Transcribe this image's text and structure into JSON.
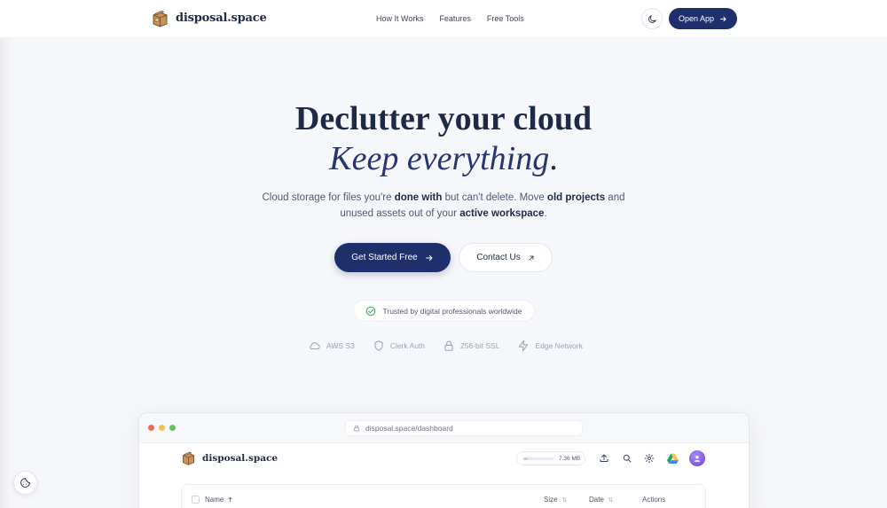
{
  "nav": {
    "brand": "disposal.space",
    "links": [
      "How It Works",
      "Features",
      "Free Tools"
    ],
    "open_app": "Open App"
  },
  "hero": {
    "title": "Declutter your cloud",
    "subtitle": "Keep everything",
    "subtitle_dot": ".",
    "desc_1": "Cloud storage for files you're ",
    "desc_b1": "done with",
    "desc_2": " but can't delete. Move ",
    "desc_b2": "old projects",
    "desc_3": " and unused assets out of your ",
    "desc_b3": "active workspace",
    "desc_4": ".",
    "cta_primary": "Get Started Free",
    "cta_secondary": "Contact Us",
    "trust": "Trusted by digital professionals worldwide",
    "badges": [
      "AWS S3",
      "Clerk Auth",
      "256-bit SSL",
      "Edge Network"
    ]
  },
  "mockup": {
    "url": "disposal.space/dashboard",
    "brand": "disposal.space",
    "storage_used": "7.36 MB",
    "storage_fraction": 0.15,
    "columns": [
      "Name",
      "Size",
      "Date",
      "Actions"
    ]
  },
  "colors": {
    "primary": "#1f2f6b",
    "background": "#f6f7fa",
    "text": "#1e2a45",
    "traffic_red": "#ef6a5e",
    "traffic_yellow": "#f5be4f",
    "traffic_green": "#61c454",
    "trust_check": "#3fae62",
    "avatar": "#6a3fd8"
  }
}
